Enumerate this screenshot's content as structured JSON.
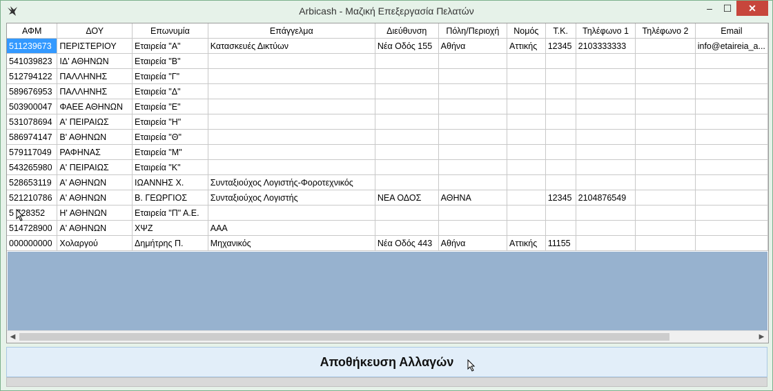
{
  "window": {
    "title": "Arbicash - Μαζική Επεξεργασία Πελατών",
    "controls": {
      "minimize": "–",
      "maximize": "☐",
      "close": "✕"
    }
  },
  "grid": {
    "columns": [
      "ΑΦΜ",
      "ΔΟΥ",
      "Επωνυμία",
      "Επάγγελμα",
      "Διεύθυνση",
      "Πόλη/Περιοχή",
      "Νομός",
      "Τ.Κ.",
      "Τηλέφωνο 1",
      "Τηλέφωνο 2",
      "Email"
    ],
    "rows": [
      [
        "511239673",
        "ΠΕΡΙΣΤΕΡΙΟΥ",
        "Εταιρεία \"Α\"",
        "Κατασκευές Δικτύων",
        "Νέα Οδός 155",
        "Αθήνα",
        "Αττικής",
        "12345",
        "2103333333",
        "",
        "info@etaireia_a..."
      ],
      [
        "541039823",
        "ΙΔ' ΑΘΗΝΩΝ",
        "Εταιρεία \"Β\"",
        "",
        "",
        "",
        "",
        "",
        "",
        "",
        ""
      ],
      [
        "512794122",
        "ΠΑΛΛΗΝΗΣ",
        "Εταιρεία \"Γ\"",
        "",
        "",
        "",
        "",
        "",
        "",
        "",
        ""
      ],
      [
        "589676953",
        "ΠΑΛΛΗΝΗΣ",
        "Εταιρεία \"Δ\"",
        "",
        "",
        "",
        "",
        "",
        "",
        "",
        ""
      ],
      [
        "503900047",
        "ΦΑΕΕ ΑΘΗΝΩΝ",
        "Εταιρεία \"Ε\"",
        "",
        "",
        "",
        "",
        "",
        "",
        "",
        ""
      ],
      [
        "531078694",
        "Α' ΠΕΙΡΑΙΩΣ",
        "Εταιρεία \"Η\"",
        "",
        "",
        "",
        "",
        "",
        "",
        "",
        ""
      ],
      [
        "586974147",
        "Β' ΑΘΗΝΩΝ",
        "Εταιρεία \"Θ\"",
        "",
        "",
        "",
        "",
        "",
        "",
        "",
        ""
      ],
      [
        "579117049",
        "ΡΑΦΗΝΑΣ",
        "Εταιρεία \"Μ\"",
        "",
        "",
        "",
        "",
        "",
        "",
        "",
        ""
      ],
      [
        "543265980",
        "Α' ΠΕΙΡΑΙΩΣ",
        "Εταιρεία \"Κ\"",
        "",
        "",
        "",
        "",
        "",
        "",
        "",
        ""
      ],
      [
        "528653119",
        "Α' ΑΘΗΝΩΝ",
        "ΙΩΑΝΝΗΣ Χ.",
        "Συνταξιούχος Λογιστής-Φοροτεχνικός",
        "",
        "",
        "",
        "",
        "",
        "",
        ""
      ],
      [
        "521210786",
        "Α' ΑΘΗΝΩΝ",
        "Β. ΓΕΩΡΓΙΟΣ",
        "Συνταξιούχος Λογιστής",
        "ΝΕΑ ΟΔΟΣ",
        "ΑΘΗΝΑ",
        "",
        "12345",
        "2104876549",
        "",
        ""
      ],
      [
        "5 728352",
        "Η' ΑΘΗΝΩΝ",
        "Εταιρεία \"Π\" Α.Ε.",
        "",
        "",
        "",
        "",
        "",
        "",
        "",
        ""
      ],
      [
        "514728900",
        "Α' ΑΘΗΝΩΝ",
        "ΧΨΖ",
        "ΑΑΑ",
        "",
        "",
        "",
        "",
        "",
        "",
        ""
      ],
      [
        "000000000",
        "Χολαργού",
        "Δημήτρης Π.",
        "Μηχανικός",
        "Νέα Οδός 443",
        "Αθήνα",
        "Αττικής",
        "11155",
        "",
        "",
        ""
      ]
    ]
  },
  "scrollbar": {
    "left_arrow": "◀",
    "right_arrow": "▶"
  },
  "save_button": {
    "label": "Αποθήκευση Αλλαγών"
  },
  "colors": {
    "selection": "#3399ff",
    "empty_area": "#97b2cf",
    "close_button": "#c7463c"
  }
}
